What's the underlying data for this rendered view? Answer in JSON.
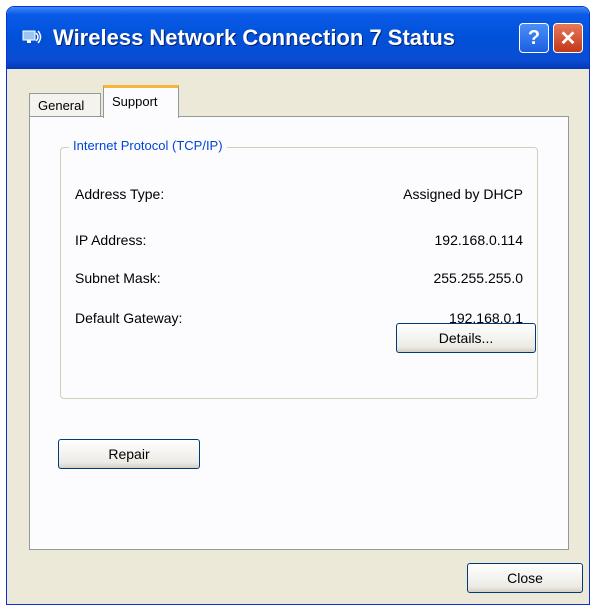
{
  "window": {
    "title": "Wireless Network Connection 7 Status",
    "help_icon": "question-icon",
    "close_icon": "close-x-icon"
  },
  "tabs": [
    {
      "label": "General",
      "active": false
    },
    {
      "label": "Support",
      "active": true
    }
  ],
  "group": {
    "title": "Internet Protocol (TCP/IP)",
    "rows": [
      {
        "label": "Address Type:",
        "value": "Assigned by DHCP"
      },
      {
        "label": "IP Address:",
        "value": "192.168.0.114"
      },
      {
        "label": "Subnet Mask:",
        "value": "255.255.255.0"
      },
      {
        "label": "Default Gateway:",
        "value": "192.168.0.1"
      }
    ]
  },
  "buttons": {
    "details": "Details...",
    "repair": "Repair",
    "close": "Close"
  },
  "colors": {
    "titlebar": "#0a5ae8",
    "tab_highlight": "#f8b53a",
    "group_title": "#0046d5",
    "face": "#ece9d8"
  }
}
